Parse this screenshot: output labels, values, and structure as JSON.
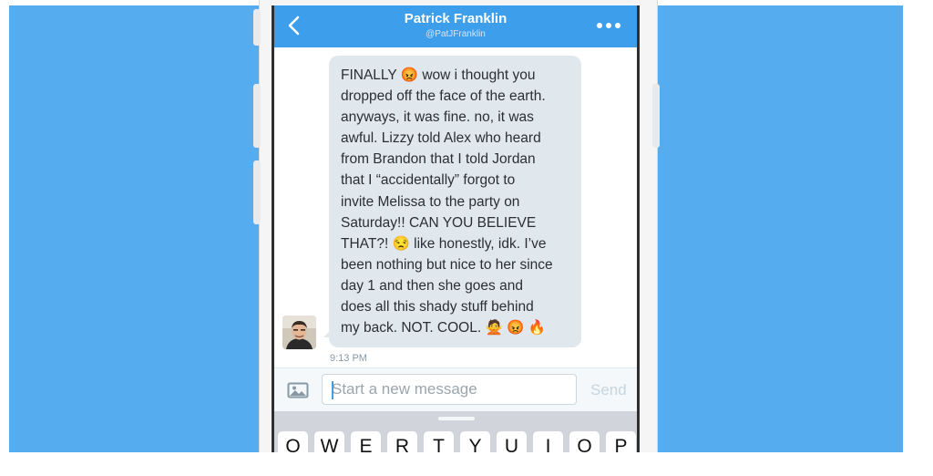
{
  "conversation": {
    "name": "Patrick Franklin",
    "handle": "@PatJFranklin"
  },
  "message": {
    "lines": [
      "FINALLY 😡 wow i thought you",
      "dropped off the face of the earth.",
      "anyways, it was fine. no, it was",
      "awful. Lizzy told Alex who heard",
      "from Brandon that I told Jordan",
      "that I “accidentally” forgot to",
      "invite Melissa to the party on",
      "Saturday!! CAN YOU BELIEVE",
      "THAT?! 😒 like honestly, idk. I’ve",
      "been nothing but nice to her since",
      "day 1 and then she goes and",
      "does all this shady stuff behind",
      "my back. NOT. COOL. 🙅 😡 🔥"
    ],
    "time": "9:13 PM"
  },
  "composer": {
    "placeholder": "Start a new message",
    "send_label": "Send"
  },
  "keyboard": {
    "row1": [
      "Q",
      "W",
      "E",
      "R",
      "T",
      "Y",
      "U",
      "I",
      "O",
      "P"
    ]
  },
  "colors": {
    "backdrop": "#55acee",
    "header": "#3d9fec",
    "bubble": "#e1e8ed"
  },
  "icons": {
    "back": "chevron-left-icon",
    "more": "more-dots-icon",
    "photo": "image-icon"
  }
}
